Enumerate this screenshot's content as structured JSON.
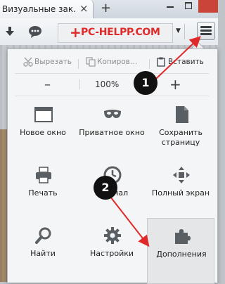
{
  "tab": {
    "title": "Визуальные зак…",
    "close": "×",
    "new_tab": "+"
  },
  "toolbar": {
    "logo_plus": "+",
    "logo_text": "PC-HELPP.COM",
    "dropdown": "▼"
  },
  "edit": {
    "cut": "Вырезать",
    "copy": "Копиров…",
    "paste": "Вставить"
  },
  "zoom": {
    "minus": "–",
    "value": "100%",
    "plus": "+"
  },
  "grid": [
    {
      "label": "Новое окно"
    },
    {
      "label": "Приватное окно"
    },
    {
      "label": "Сохранить страницу"
    },
    {
      "label": "Печать"
    },
    {
      "label": "Журнал"
    },
    {
      "label": "Полный экран"
    },
    {
      "label": "Найти"
    },
    {
      "label": "Настройки"
    },
    {
      "label": "Дополнения"
    }
  ],
  "annotations": {
    "badge1": "1",
    "badge2": "2",
    "arrow_color": "#e02a2a"
  }
}
